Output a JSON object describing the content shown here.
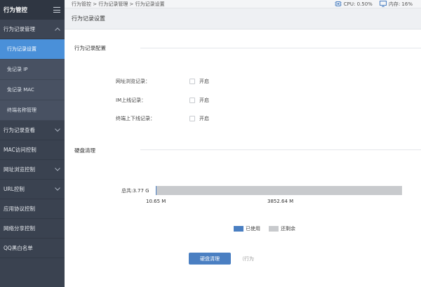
{
  "app": {
    "title": "行为管控"
  },
  "sidebar": {
    "groups": [
      {
        "label": "行为记录管理",
        "expanded": true,
        "items": [
          {
            "label": "行为记录设置",
            "active": true
          },
          {
            "label": "免记录 IP"
          },
          {
            "label": "免记录 MAC"
          },
          {
            "label": "终端名称管理"
          }
        ]
      },
      {
        "label": "行为记录查看",
        "has_chevron": true
      },
      {
        "label": "MAC访问控制",
        "has_chevron": false
      },
      {
        "label": "网址浏览控制",
        "has_chevron": true
      },
      {
        "label": "URL控制",
        "has_chevron": true
      },
      {
        "label": "应用协议控制",
        "has_chevron": false
      },
      {
        "label": "网络分享控制",
        "has_chevron": false
      },
      {
        "label": "QQ黑白名单",
        "has_chevron": false
      }
    ]
  },
  "topbar": {
    "breadcrumb": "行为管控 > 行为记录管理 > 行为记录设置",
    "cpu": "CPU: 0.50%",
    "mem": "内存: 16%"
  },
  "page": {
    "title": "行为记录设置"
  },
  "config": {
    "title": "行为记录配置",
    "rows": [
      {
        "label": "网址浏览记录：",
        "option": "开启"
      },
      {
        "label": "IM上线记录：",
        "option": "开启"
      },
      {
        "label": "终端上下线记录：",
        "option": "开启"
      }
    ]
  },
  "disk": {
    "title": "硬盘清理",
    "total_label": "总共:3.77 G",
    "used_label": "10.65 M",
    "remain_label": "3852.64 M",
    "used_fraction": 0.0028,
    "legend_used": "已使用",
    "legend_remain": "还剩余",
    "used_color": "#4a7fc2",
    "remain_color": "#c8cacd"
  },
  "actions": {
    "clean_button": "硬盘清理",
    "note": "（行为"
  }
}
